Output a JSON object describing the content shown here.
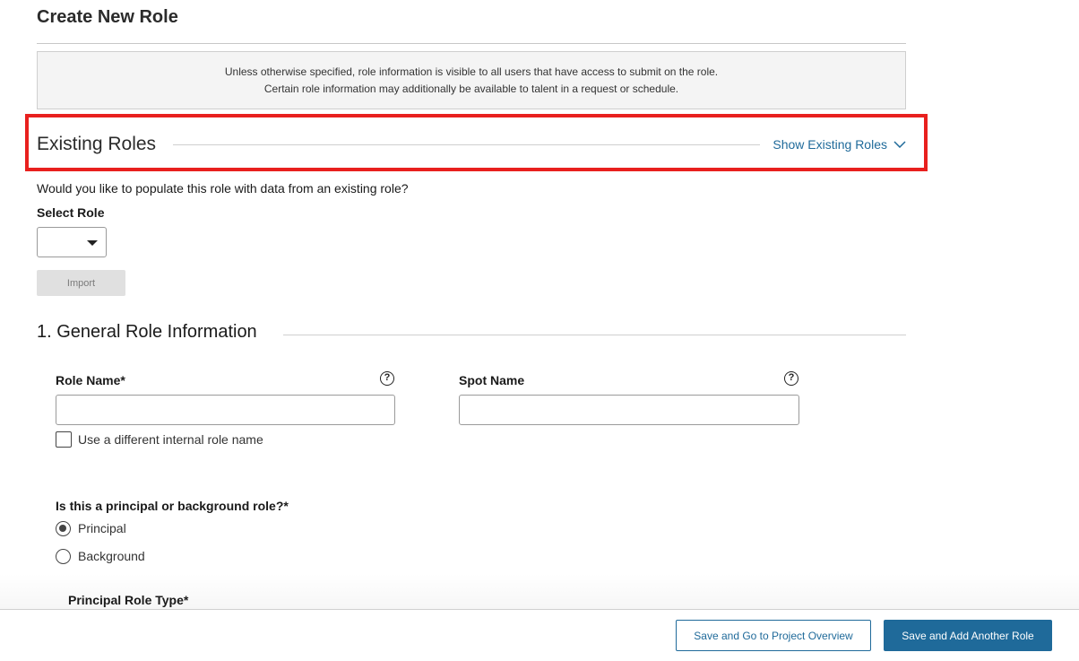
{
  "page": {
    "title": "Create New Role"
  },
  "info": {
    "line1": "Unless otherwise specified, role information is visible to all users that have access to submit on the role.",
    "line2": "Certain role information may additionally be available to talent in a request or schedule."
  },
  "existing_roles": {
    "title": "Existing Roles",
    "toggle_label": "Show Existing Roles",
    "question": "Would you like to populate this role with data from an existing role?",
    "select_label": "Select Role",
    "select_value": "",
    "import_label": "Import"
  },
  "general": {
    "section_title": "1. General Role Information",
    "role_name_label": "Role Name*",
    "role_name_value": "",
    "spot_name_label": "Spot Name",
    "spot_name_value": "",
    "help_glyph": "?",
    "internal_name_checkbox_label": "Use a different internal role name",
    "internal_name_checked": false,
    "role_kind_question": "Is this a principal or background role?*",
    "role_kind_options": [
      "Principal",
      "Background"
    ],
    "role_kind_selected": "Principal",
    "principal_type_label": "Principal Role Type*"
  },
  "footer": {
    "save_overview_label": "Save and Go to Project Overview",
    "save_add_label": "Save and Add Another Role"
  },
  "colors": {
    "accent": "#1f6a9a",
    "highlight_border": "#e8201e"
  }
}
